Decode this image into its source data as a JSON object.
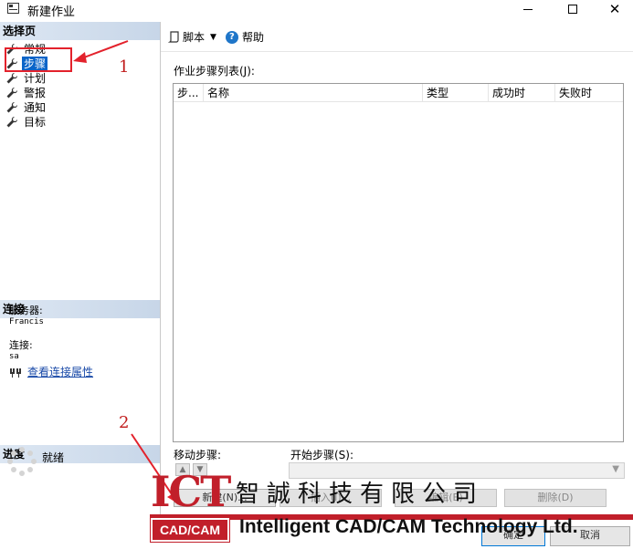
{
  "window": {
    "title": "新建作业"
  },
  "left_panel": {
    "select_page_header": "选择页",
    "pages": [
      {
        "label": "常规"
      },
      {
        "label": "步骤",
        "selected": true
      },
      {
        "label": "计划"
      },
      {
        "label": "警报"
      },
      {
        "label": "通知"
      },
      {
        "label": "目标"
      }
    ],
    "connection_header": "连接",
    "server_label": "服务器:",
    "server_value": "Francis",
    "connection_label": "连接:",
    "connection_value": "sa",
    "view_props_link": "查看连接属性",
    "progress_header": "进度",
    "progress_status": "就绪"
  },
  "toolbar": {
    "script_label": "脚本",
    "help_label": "帮助"
  },
  "steps": {
    "list_label": "作业步骤列表(J):",
    "columns": [
      "步...",
      "名称",
      "类型",
      "成功时",
      "失败时"
    ],
    "move_label": "移动步骤:",
    "start_label": "开始步骤(S):"
  },
  "buttons": {
    "new": "新建(N)...",
    "insert": "插入(I)...",
    "edit": "编辑(E)",
    "delete": "删除(D)",
    "ok": "确定",
    "cancel": "取消"
  },
  "annotations": {
    "one": "1",
    "two": "2"
  },
  "logo": {
    "letters": "ICT",
    "tag": "CAD/CAM",
    "chinese": "智誠科技有限公司",
    "english": "Intelligent CAD/CAM Technology Ltd."
  },
  "colors": {
    "accent": "#0a64c8",
    "annotation": "#e3222c",
    "brand": "#c11f2a"
  }
}
